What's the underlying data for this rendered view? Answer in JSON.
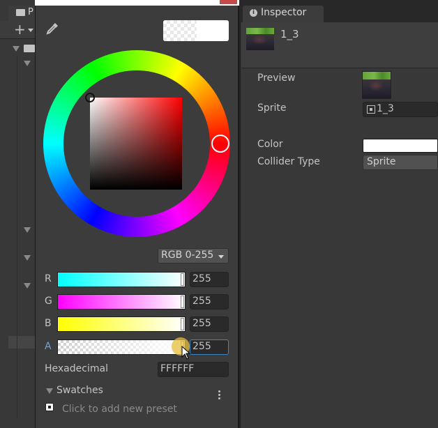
{
  "project": {
    "tab_label": "P"
  },
  "inspector": {
    "tab_label": "Inspector",
    "object_name": "1_3",
    "fields": {
      "preview_label": "Preview",
      "sprite_label": "Sprite",
      "sprite_value": "1_3",
      "color_label": "Color",
      "color_value": "#FFFFFF",
      "collider_label": "Collider Type",
      "collider_value": "Sprite"
    }
  },
  "picker": {
    "mode": "RGB 0-255",
    "current_color": "#FFFFFF",
    "channels": [
      {
        "label": "R",
        "value": "255"
      },
      {
        "label": "G",
        "value": "255"
      },
      {
        "label": "B",
        "value": "255"
      },
      {
        "label": "A",
        "value": "255"
      }
    ],
    "hex_label": "Hexadecimal",
    "hex_value": "FFFFFF",
    "swatches_label": "Swatches",
    "add_preset_text": "Click to add new preset"
  }
}
